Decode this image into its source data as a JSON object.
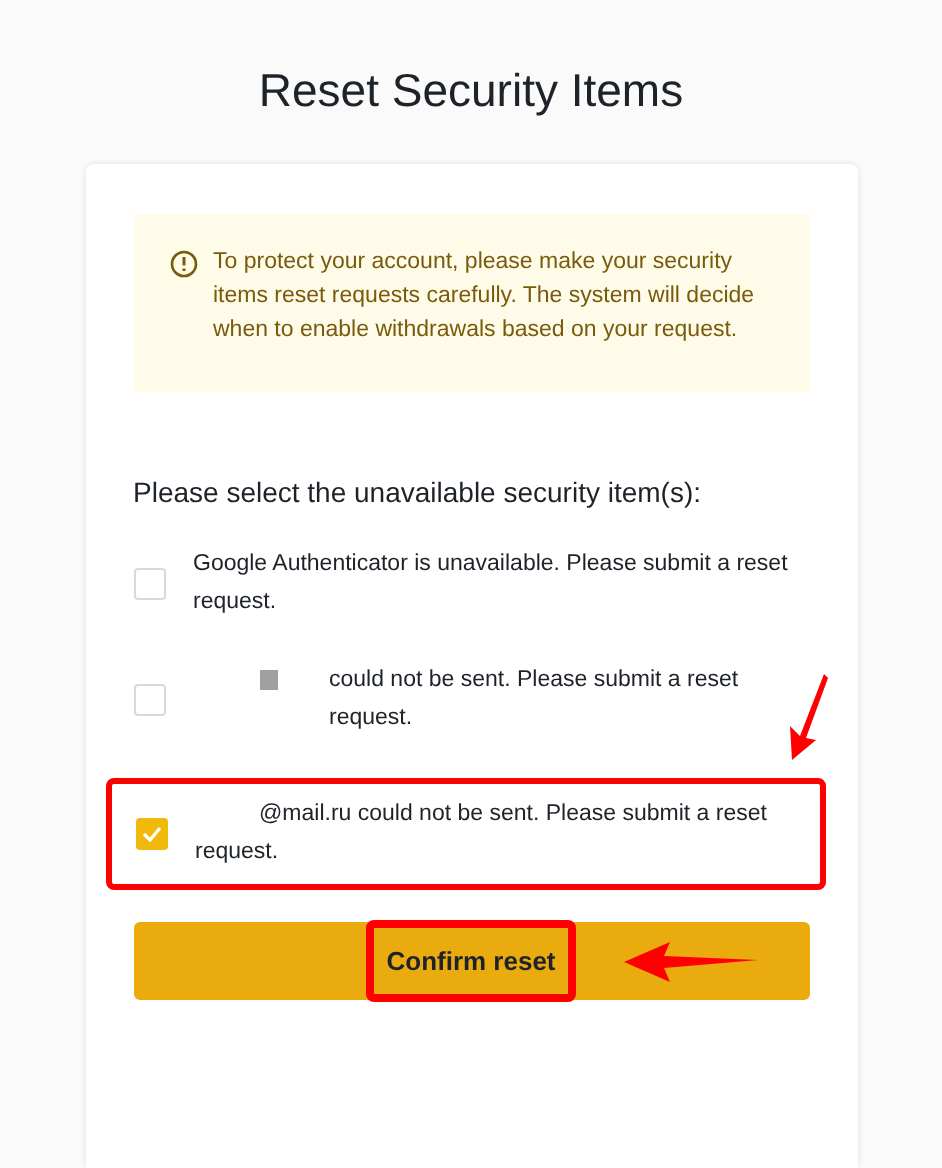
{
  "title": "Reset Security Items",
  "notice": "To protect your account, please make your security items reset requests carefully. The system will decide when to enable withdrawals based on your request.",
  "prompt": "Please select the unavailable security item(s):",
  "options": [
    {
      "text": "Google Authenticator is unavailable. Please submit a reset request.",
      "checked": false,
      "redacted": false,
      "highlighted": false
    },
    {
      "text": "could not be sent. Please submit a reset request.",
      "checked": false,
      "redacted": true,
      "highlighted": false
    },
    {
      "text": "@mail.ru could not be sent. Please submit a reset request.",
      "checked": true,
      "redacted": false,
      "highlighted": true
    }
  ],
  "button": {
    "label": "Confirm reset",
    "highlighted": true
  }
}
